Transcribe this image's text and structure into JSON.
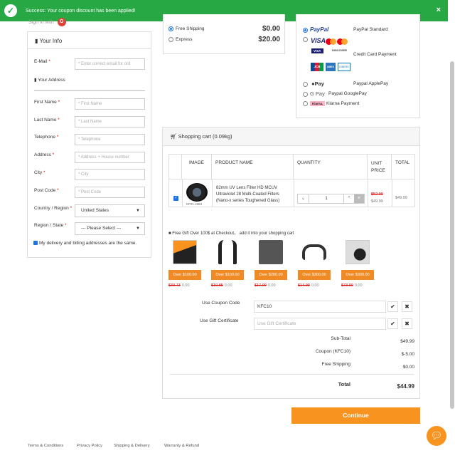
{
  "banner": {
    "message": "Success: Your coupon discount has been applied!",
    "close": "×"
  },
  "signin": {
    "label": "Sign in with",
    "google": "G"
  },
  "info": {
    "title": "Your Info",
    "email_label": "E-Mail",
    "email_placeholder": "* Enter correct email for ord",
    "address_heading": "Your Address",
    "fields": [
      {
        "label": "First Name",
        "placeholder": "* First Name"
      },
      {
        "label": "Last Name",
        "placeholder": "* Last Name"
      },
      {
        "label": "Telephone",
        "placeholder": "* Telephone"
      },
      {
        "label": "Address",
        "placeholder": "* Address + House number"
      },
      {
        "label": "City",
        "placeholder": "* City"
      },
      {
        "label": "Post Code",
        "placeholder": "* Post Code"
      }
    ],
    "country_label": "Country / Region",
    "country_value": "United States",
    "region_label": "Region / State",
    "region_value": "--- Please Select ---",
    "same_address": "My delivery and billing addresses are the same."
  },
  "shipping": [
    {
      "label": "Free Shipping",
      "price": "$0.00",
      "selected": true
    },
    {
      "label": "Express",
      "price": "$20.00",
      "selected": false
    }
  ],
  "payment": {
    "paypal_logo": "PayPal",
    "paypal_label": "PayPal Standard",
    "cards": [
      "VISA",
      "DISCOVER",
      "JCB",
      "AMEX",
      "DINERS"
    ],
    "card_label": "Credit Card Payment",
    "applepay_logo": "Pay",
    "applepay_label": "Paypal ApplePay",
    "googlepay_logo": "G Pay",
    "googlepay_label": "Paypal GooglePay",
    "klarna_logo": "Klarna.",
    "klarna_label": "Klarna Payment"
  },
  "cart": {
    "title": "Shopping cart  (0.09kg)",
    "headers": [
      "IMAGE",
      "PRODUCT NAME",
      "QUANTITY",
      "UNIT PRICE",
      "TOTAL"
    ],
    "item": {
      "sku": "KF01.1863",
      "name": "82mm UV Lens Filter HD MCUV Ultraviolet 28 Multi-Coated Filters (Nano-x series Toughened Glass)",
      "qty": "1",
      "unit_old": "$52.99",
      "unit_new": "$49.99",
      "total": "$49.99"
    },
    "gift_heading": "Free Gift Over 100$ at Checkout，  add it into your shopping cart",
    "gifts": [
      {
        "badge": "Over $100.00",
        "old": "$33.73",
        "new": "0.00"
      },
      {
        "badge": "Over $100.00",
        "old": "$19.85",
        "new": "0.00"
      },
      {
        "badge": "Over $200.00",
        "old": "$17.99",
        "new": "0.00"
      },
      {
        "badge": "Over $300.00",
        "old": "$14.99",
        "new": "0.00"
      },
      {
        "badge": "Over $300.00",
        "old": "$73.99",
        "new": "0.00"
      }
    ],
    "coupon_label": "Use Coupon Code",
    "coupon_value": "KFC10",
    "gift_cert_label": "Use Gift Certificate",
    "gift_cert_placeholder": "Use Gift Certificate",
    "totals": [
      {
        "label": "Sub-Total",
        "value": "$49.99"
      },
      {
        "label": "Coupon (KFC10)",
        "value": "$-5.00"
      },
      {
        "label": "Free Shipping",
        "value": "$0.00"
      }
    ],
    "total_label": "Total",
    "total_value": "$44.99"
  },
  "continue_label": "Continue",
  "footer": [
    "Terms & Conditions",
    "Privacy Policy",
    "Shipping & Delivery",
    "Warranty & Refund"
  ],
  "colors": {
    "success": "#27a844",
    "accent": "#f7931e",
    "link": "#1a73e8"
  }
}
